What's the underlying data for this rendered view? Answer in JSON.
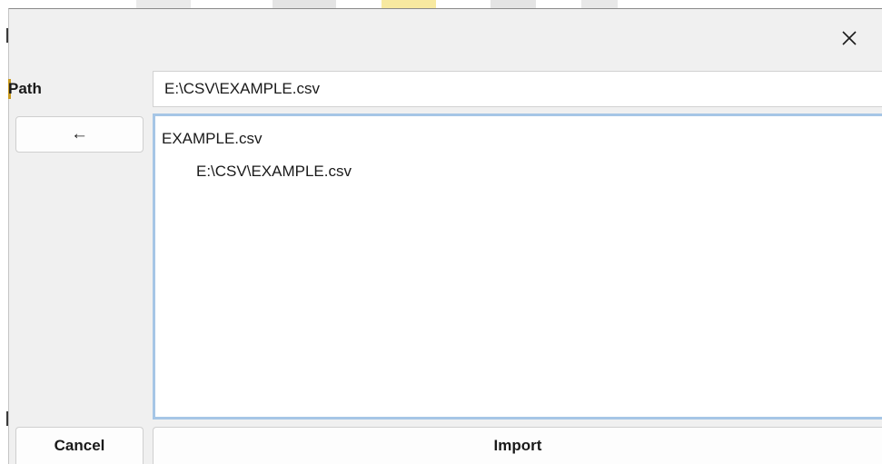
{
  "dialog": {
    "close_icon": "close-icon",
    "path_label": "Path",
    "path_value": "E:\\CSV\\EXAMPLE.csv",
    "back_label": "←",
    "file_list": {
      "items": [
        {
          "name": "EXAMPLE.csv",
          "path": "E:\\CSV\\EXAMPLE.csv"
        }
      ]
    },
    "cancel_label": "Cancel",
    "import_label": "Import"
  },
  "colors": {
    "dialog_background": "#f0f0f0",
    "list_focus_border": "#a6c6e6",
    "label_accent": "#c99a1e",
    "text": "#1a1a1a"
  }
}
